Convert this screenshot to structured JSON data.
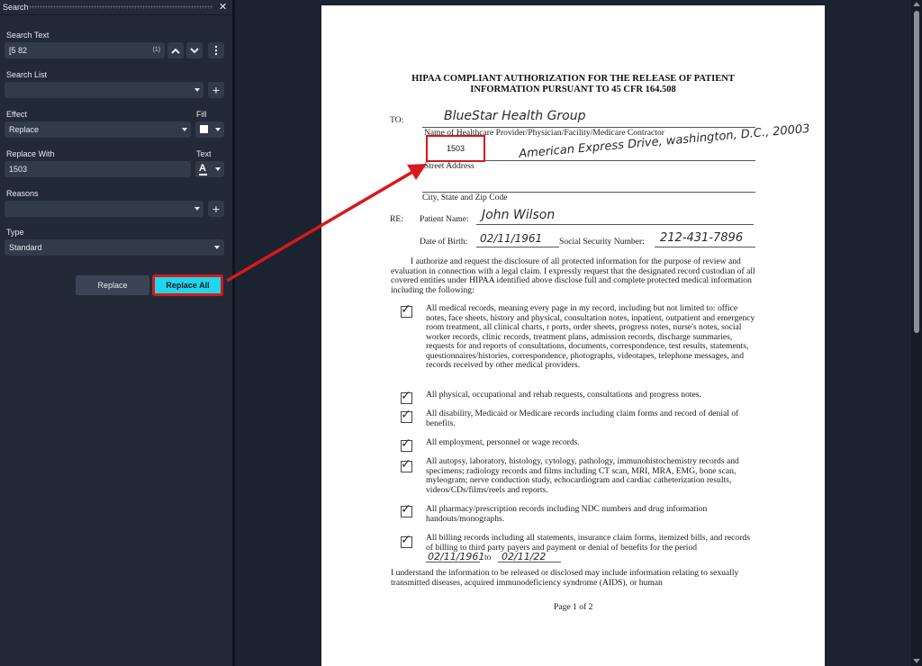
{
  "panel": {
    "title": "Search",
    "search_text_label": "Search Text",
    "search_text_value": "[5 82",
    "match_count": "(1)",
    "search_list_label": "Search List",
    "effect_label": "Effect",
    "effect_value": "Replace",
    "fill_label": "Fill",
    "replace_with_label": "Replace With",
    "replace_with_value": "1503",
    "text_label": "Text",
    "text_icon_glyph": "A",
    "reasons_label": "Reasons",
    "type_label": "Type",
    "type_value": "Standard",
    "replace_button": "Replace",
    "replace_all_button": "Replace All"
  },
  "document": {
    "title_line1": "HIPAA COMPLIANT AUTHORIZATION FOR THE RELEASE OF PATIENT",
    "title_line2": "INFORMATION PURSUANT TO 45 CFR 164.508",
    "to_label": "TO:",
    "provider_handwritten": "BlueStar Health Group",
    "provider_caption": "Name of Healthcare Provider/Physician/Facility/Medicare Contractor",
    "redacted_text": "1503",
    "address_handwritten": "American Express Drive, washington, D.C., 20003",
    "street_caption": "Street Address",
    "city_caption": "City, State and Zip Code",
    "re_label": "RE:",
    "patient_name_label": "Patient Name:",
    "patient_name_handwritten": "John Wilson",
    "dob_label": "Date of Birth:",
    "dob_handwritten": "02/11/1961",
    "ssn_label": "Social Security Number:",
    "ssn_handwritten": "212-431-7896",
    "intro_paragraph": "I authorize and request the disclosure of all protected information for the purpose of review and evaluation in connection with a legal claim. I expressly request that the designated record custodian of all covered entities under HIPAA identified above disclose full and complete protected medical information including the following:",
    "items": [
      "All medical records, meaning every page in my record, including but not limited to: office notes, face sheets, history and physical, consultation notes, inpatient, outpatient and emergency room treatment, all clinical charts, r ports, order sheets, progress notes, nurse's notes, social worker records, clinic records, treatment plans, admission records, discharge summaries, requests for and reports of consultations, documents, correspondence, test results, statements, questionnaires/histories, correspondence, photographs, videotapes, telephone messages, and records received by other medical providers.",
      "All physical, occupational and rehab requests, consultations and progress notes.",
      "All disability, Medicaid or Medicare records including claim forms and record of denial of benefits.",
      "All employment, personnel or wage records.",
      "All autopsy, laboratory, histology, cytology, pathology, immunohistochemistry records and specimens; radiology records and films including CT scan, MRI, MRA, EMG, bone scan, myleogram; nerve conduction study, echocardiogram and cardiac catheterization results, videos/CDs/films/reels and reports.",
      "All pharmacy/prescription records including NDC numbers and drug information handouts/monographs.",
      "All billing records including all statements, insurance claim forms, itemized bills, and records of billing to third party payers and payment or denial of benefits for the period"
    ],
    "period_from": "02/11/1961",
    "period_to_word": "to",
    "period_to": "02/11/22",
    "closing_paragraph": "I understand the information to be released or disclosed may include information relating to sexually transmitted diseases, acquired immunodeficiency syndrome (AIDS), or human",
    "page_footer": "Page 1 of 2"
  },
  "colors": {
    "panel_bg": "#222a38",
    "field_bg": "#323b4a",
    "accent_button": "#1fd6ea",
    "highlight_red": "#d6191c"
  }
}
